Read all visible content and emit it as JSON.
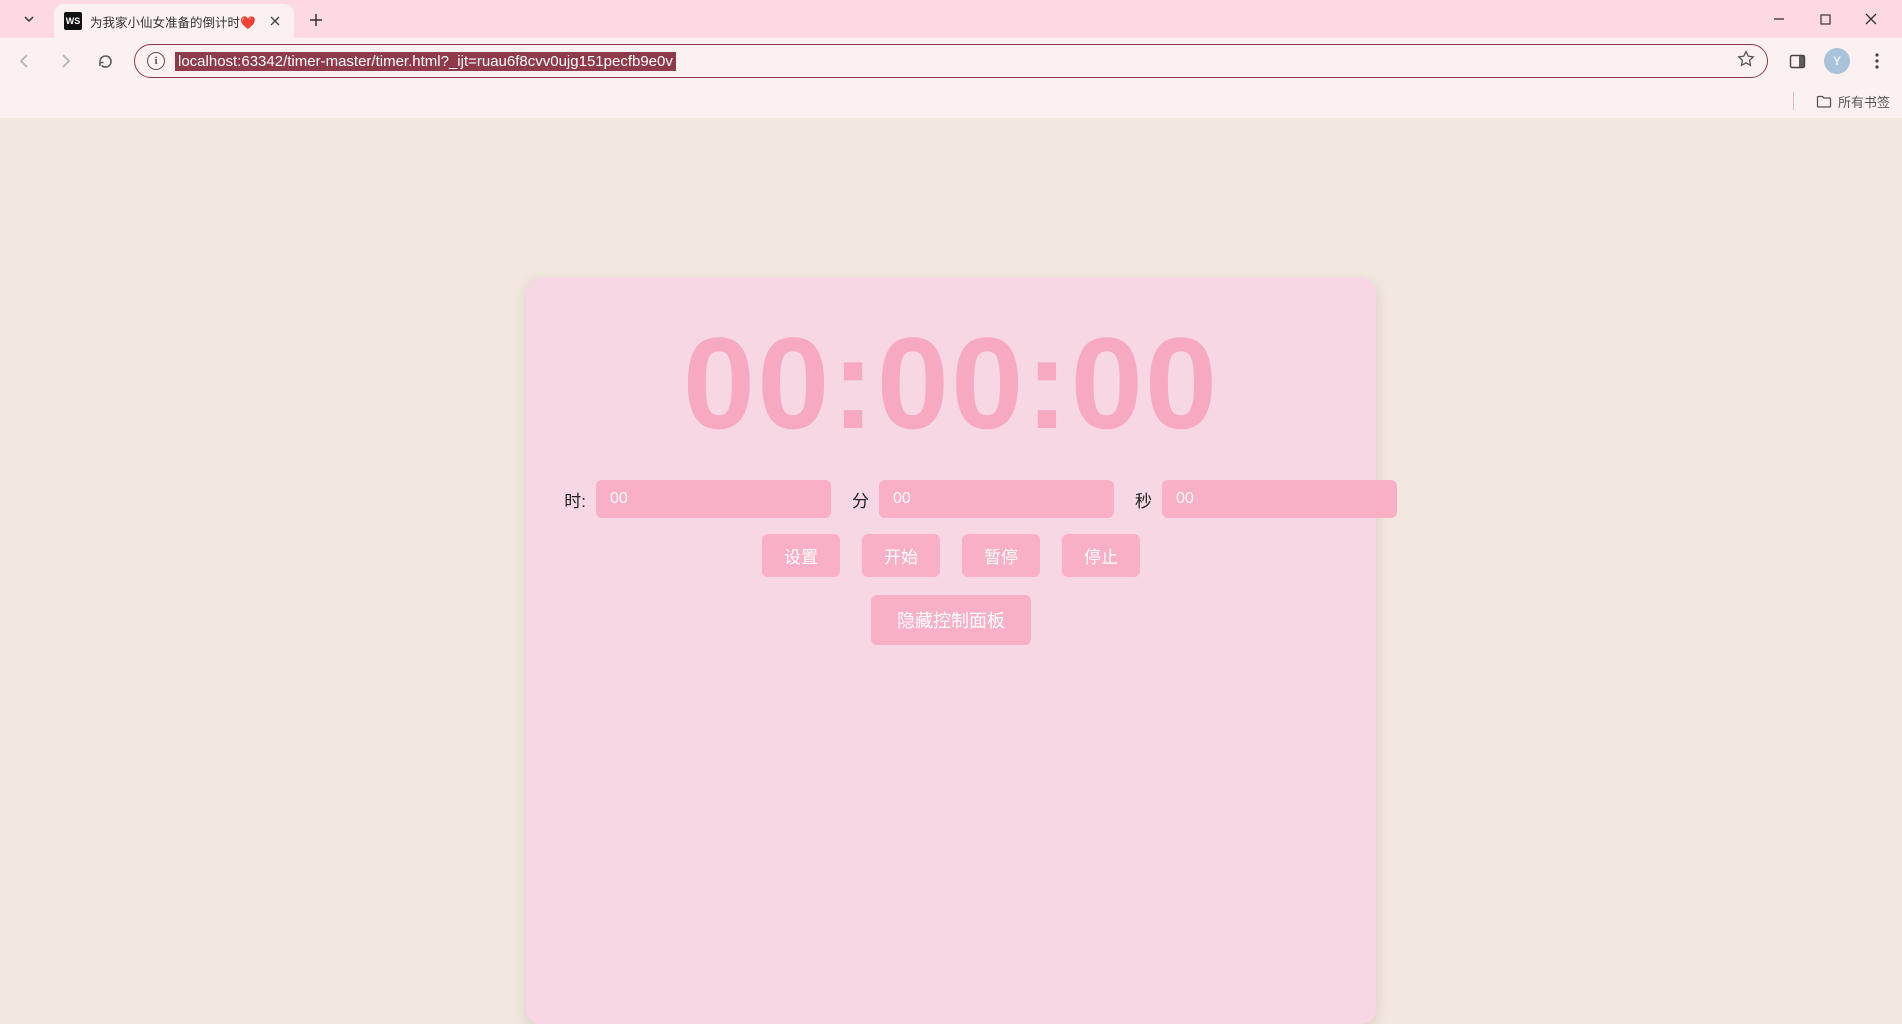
{
  "browser": {
    "tab": {
      "favicon_text": "WS",
      "title": "为我家小仙女准备的倒计时❤️"
    },
    "omnibox": {
      "url": "localhost:63342/timer-master/timer.html?_ijt=ruau6f8cvv0ujg151pecfb9e0v"
    },
    "avatar_letter": "Y",
    "bookmarks": {
      "all": "所有书签"
    }
  },
  "timer": {
    "display": "00:00:00",
    "labels": {
      "hour": "时:",
      "minute": "分",
      "second": "秒"
    },
    "inputs": {
      "hour_placeholder": "00",
      "minute_placeholder": "00",
      "second_placeholder": "00"
    },
    "buttons": {
      "set": "设置",
      "start": "开始",
      "pause": "暂停",
      "stop": "停止",
      "hide_panel": "隐藏控制面板"
    }
  }
}
